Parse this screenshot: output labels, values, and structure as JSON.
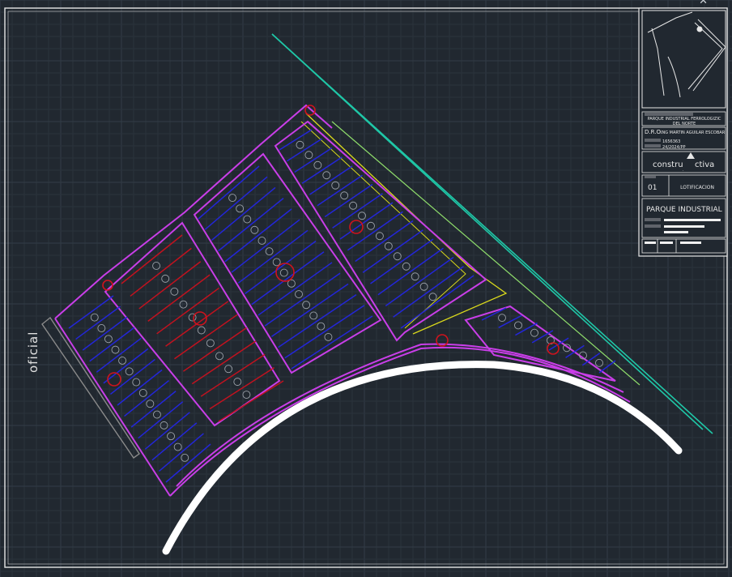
{
  "drawing": {
    "side_label": "oficial",
    "colors": {
      "background": "#212830",
      "frame": "#e6e6e6",
      "boundary": "#c93ee8",
      "lot_lines_blue": "#2326d8",
      "lot_lines_red": "#c1121f",
      "road_curve": "#ffffff",
      "highway": "#1fc7a7",
      "yellow_line": "#d9d81c"
    }
  },
  "title_block": {
    "project_line1": "PARQUE INDUSTRIAL FERROLOGIZIC",
    "project_line2": "DEL NORTE",
    "dro_label": "D.R.O.",
    "dro_name": "ING MARTIN AGUILAR ESCOBAR",
    "field_1": "1656363",
    "field_2": "24/2024/PP",
    "logo_left": "constru",
    "logo_right": "ctiva",
    "sheet_number": "01",
    "sheet_title": "LOTIFICACION",
    "main_title": "PARQUE INDUSTRIAL"
  }
}
